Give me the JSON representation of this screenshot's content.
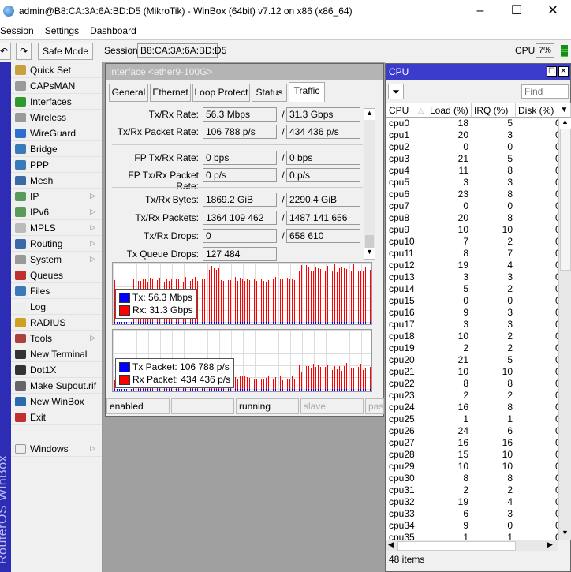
{
  "window": {
    "title": "admin@B8:CA:3A:6A:BD:D5 (MikroTik) - WinBox (64bit) v7.12 on x86 (x86_64)",
    "minimize": "–",
    "maximize": "☐",
    "close": "✕"
  },
  "menu": [
    "Session",
    "Settings",
    "Dashboard"
  ],
  "toolbar": {
    "undo": "↶",
    "redo": "↷",
    "safe_mode": "Safe Mode",
    "session_label": "Session:",
    "session_value": "B8:CA:3A:6A:BD:D5",
    "cpu_label": "CPU:",
    "cpu_value": "7%"
  },
  "sidebar": {
    "brand": "RouterOS WinBox",
    "items": [
      {
        "label": "Quick Set",
        "icon": "wand-icon",
        "color": "#c8a040"
      },
      {
        "label": "CAPsMAN",
        "icon": "antenna-icon",
        "color": "#9a9a9a"
      },
      {
        "label": "Interfaces",
        "icon": "interfaces-icon",
        "color": "#2e9a2e"
      },
      {
        "label": "Wireless",
        "icon": "antenna-icon",
        "color": "#9a9a9a"
      },
      {
        "label": "WireGuard",
        "icon": "wireguard-icon",
        "color": "#2e6fd0"
      },
      {
        "label": "Bridge",
        "icon": "bridge-icon",
        "color": "#3a7ab8"
      },
      {
        "label": "PPP",
        "icon": "ppp-icon",
        "color": "#3a7ab8"
      },
      {
        "label": "Mesh",
        "icon": "mesh-icon",
        "color": "#3a6aa8"
      },
      {
        "label": "IP",
        "icon": "ip-icon",
        "color": "#5a9a5a",
        "sub": true
      },
      {
        "label": "IPv6",
        "icon": "ipv6-icon",
        "color": "#5a9a5a",
        "sub": true
      },
      {
        "label": "MPLS",
        "icon": "mpls-icon",
        "color": "#bbbbbb",
        "sub": true
      },
      {
        "label": "Routing",
        "icon": "routing-icon",
        "color": "#3a6aa8",
        "sub": true
      },
      {
        "label": "System",
        "icon": "gear-icon",
        "color": "#999999",
        "sub": true
      },
      {
        "label": "Queues",
        "icon": "queues-icon",
        "color": "#c03030"
      },
      {
        "label": "Files",
        "icon": "files-icon",
        "color": "#3a7ab8"
      },
      {
        "label": "Log",
        "icon": "log-icon",
        "color": "#eeeeee"
      },
      {
        "label": "RADIUS",
        "icon": "radius-icon",
        "color": "#d0a020"
      },
      {
        "label": "Tools",
        "icon": "tools-icon",
        "color": "#b04040",
        "sub": true
      },
      {
        "label": "New Terminal",
        "icon": "terminal-icon",
        "color": "#333333"
      },
      {
        "label": "Dot1X",
        "icon": "dot1x-icon",
        "color": "#333333"
      },
      {
        "label": "Make Supout.rif",
        "icon": "supout-icon",
        "color": "#666666"
      },
      {
        "label": "New WinBox",
        "icon": "winbox-icon",
        "color": "#2a6bb0"
      },
      {
        "label": "Exit",
        "icon": "exit-icon",
        "color": "#c03030"
      }
    ],
    "windows": "Windows"
  },
  "iface": {
    "title": "Interface <ether9-100G>",
    "tabs": [
      "General",
      "Ethernet",
      "Loop Protect",
      "Status",
      "Traffic"
    ],
    "active_tab": "Traffic",
    "fields": [
      {
        "label": "Tx/Rx Rate:",
        "tx": "56.3 Mbps",
        "rx": "31.3 Gbps"
      },
      {
        "label": "Tx/Rx Packet Rate:",
        "tx": "106 788 p/s",
        "rx": "434 436 p/s"
      },
      {
        "label": "FP Tx/Rx Rate:",
        "tx": "0 bps",
        "rx": "0 bps"
      },
      {
        "label": "FP Tx/Rx Packet Rate:",
        "tx": "0 p/s",
        "rx": "0 p/s"
      },
      {
        "label": "Tx/Rx Bytes:",
        "tx": "1869.2 GiB",
        "rx": "2290.4 GiB"
      },
      {
        "label": "Tx/Rx Packets:",
        "tx": "1364 109 462",
        "rx": "1487 141 656"
      },
      {
        "label": "Tx/Rx Drops:",
        "tx": "0",
        "rx": "658 610"
      },
      {
        "label": "Tx Queue Drops:",
        "tx": "127 484"
      }
    ],
    "slash": "/",
    "graph1": {
      "tx": "Tx:  56.3 Mbps",
      "rx": "Rx:  31.3 Gbps"
    },
    "graph2": {
      "tx": "Tx Packet:  106 788 p/s",
      "rx": "Rx Packet:  434 436 p/s"
    },
    "colors": {
      "tx": "#0000ff",
      "rx": "#ff0000"
    },
    "status": [
      "enabled",
      "",
      "running",
      "slave",
      "pass"
    ]
  },
  "cpu": {
    "title": "CPU",
    "find_placeholder": "Find",
    "columns": [
      "CPU",
      "Load (%)",
      "IRQ (%)",
      "Disk (%)"
    ],
    "rows": [
      [
        "cpu0",
        18,
        5,
        0
      ],
      [
        "cpu1",
        20,
        3,
        0
      ],
      [
        "cpu2",
        0,
        0,
        0
      ],
      [
        "cpu3",
        21,
        5,
        0
      ],
      [
        "cpu4",
        11,
        8,
        0
      ],
      [
        "cpu5",
        3,
        3,
        0
      ],
      [
        "cpu6",
        23,
        8,
        0
      ],
      [
        "cpu7",
        0,
        0,
        0
      ],
      [
        "cpu8",
        20,
        8,
        0
      ],
      [
        "cpu9",
        10,
        10,
        0
      ],
      [
        "cpu10",
        7,
        2,
        0
      ],
      [
        "cpu11",
        8,
        7,
        0
      ],
      [
        "cpu12",
        19,
        4,
        0
      ],
      [
        "cpu13",
        3,
        3,
        0
      ],
      [
        "cpu14",
        5,
        2,
        0
      ],
      [
        "cpu15",
        0,
        0,
        0
      ],
      [
        "cpu16",
        9,
        3,
        0
      ],
      [
        "cpu17",
        3,
        3,
        0
      ],
      [
        "cpu18",
        10,
        2,
        0
      ],
      [
        "cpu19",
        2,
        2,
        0
      ],
      [
        "cpu20",
        21,
        5,
        0
      ],
      [
        "cpu21",
        10,
        10,
        0
      ],
      [
        "cpu22",
        8,
        8,
        0
      ],
      [
        "cpu23",
        2,
        2,
        0
      ],
      [
        "cpu24",
        16,
        8,
        0
      ],
      [
        "cpu25",
        1,
        1,
        0
      ],
      [
        "cpu26",
        24,
        6,
        0
      ],
      [
        "cpu27",
        16,
        16,
        0
      ],
      [
        "cpu28",
        15,
        10,
        0
      ],
      [
        "cpu29",
        10,
        10,
        0
      ],
      [
        "cpu30",
        8,
        8,
        0
      ],
      [
        "cpu31",
        2,
        2,
        0
      ],
      [
        "cpu32",
        19,
        4,
        0
      ],
      [
        "cpu33",
        6,
        3,
        0
      ],
      [
        "cpu34",
        9,
        0,
        0
      ],
      [
        "cpu35",
        1,
        1,
        0
      ]
    ],
    "status": "48 items"
  }
}
